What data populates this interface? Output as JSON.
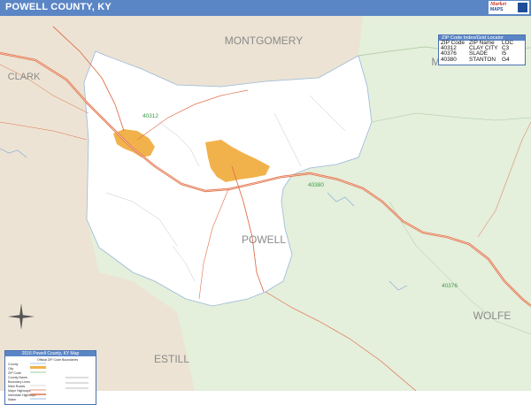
{
  "header": {
    "title": "POWELL COUNTY, KY"
  },
  "logo": {
    "line1": "Market",
    "line2": "MAPS"
  },
  "map": {
    "county_label": "POWELL",
    "neighbors": [
      "MONTGOMERY",
      "MENIFEE",
      "CLARK",
      "ESTILL",
      "WOLFE"
    ],
    "zip_labels": [
      "40312",
      "40380",
      "40376"
    ]
  },
  "zip_locator": {
    "title": "ZIP Code Index/Grid Locator",
    "columns": [
      "ZIP Code",
      "ZIP Name",
      "LOC"
    ],
    "rows": [
      [
        "40312",
        "CLAY CITY",
        "C3"
      ],
      [
        "40376",
        "SLADE",
        "I5"
      ],
      [
        "40380",
        "STANTON",
        "G4"
      ]
    ]
  },
  "legend": {
    "title": "2016 Powell County, KY Map",
    "subtitle": "Official ZIP Code Boundaries",
    "items": [
      "County",
      "City",
      "ZIP Code",
      "County Name",
      "Boundary Lines",
      "Main Roads",
      "Major Highways",
      "Interstate Highways",
      "Water"
    ]
  },
  "colors": {
    "title_bar": "#5b86c5",
    "county_fill": "#ffffff",
    "neighbor_fill": "#e4efdc",
    "urban_fill": "#f2b24b",
    "road": "#e0704a",
    "zip_label": "#3e9a4a"
  }
}
